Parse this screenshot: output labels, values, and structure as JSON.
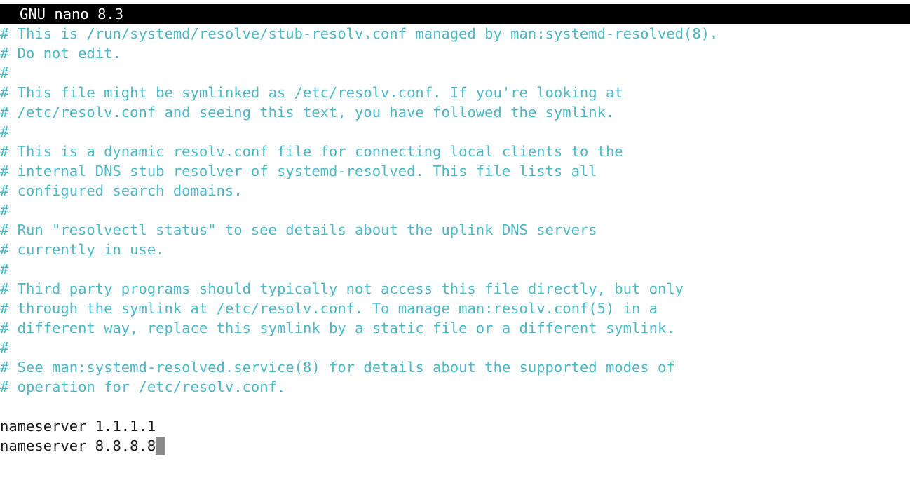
{
  "app": {
    "title": "GNU nano 8.3"
  },
  "editor": {
    "lines": [
      {
        "kind": "comment",
        "text": "# This is /run/systemd/resolve/stub-resolv.conf managed by man:systemd-resolved(8)."
      },
      {
        "kind": "comment",
        "text": "# Do not edit."
      },
      {
        "kind": "comment",
        "text": "#"
      },
      {
        "kind": "comment",
        "text": "# This file might be symlinked as /etc/resolv.conf. If you're looking at"
      },
      {
        "kind": "comment",
        "text": "# /etc/resolv.conf and seeing this text, you have followed the symlink."
      },
      {
        "kind": "comment",
        "text": "#"
      },
      {
        "kind": "comment",
        "text": "# This is a dynamic resolv.conf file for connecting local clients to the"
      },
      {
        "kind": "comment",
        "text": "# internal DNS stub resolver of systemd-resolved. This file lists all"
      },
      {
        "kind": "comment",
        "text": "# configured search domains."
      },
      {
        "kind": "comment",
        "text": "#"
      },
      {
        "kind": "comment",
        "text": "# Run \"resolvectl status\" to see details about the uplink DNS servers"
      },
      {
        "kind": "comment",
        "text": "# currently in use."
      },
      {
        "kind": "comment",
        "text": "#"
      },
      {
        "kind": "comment",
        "text": "# Third party programs should typically not access this file directly, but only"
      },
      {
        "kind": "comment",
        "text": "# through the symlink at /etc/resolv.conf. To manage man:resolv.conf(5) in a"
      },
      {
        "kind": "comment",
        "text": "# different way, replace this symlink by a static file or a different symlink."
      },
      {
        "kind": "comment",
        "text": "#"
      },
      {
        "kind": "comment",
        "text": "# See man:systemd-resolved.service(8) for details about the supported modes of"
      },
      {
        "kind": "comment",
        "text": "# operation for /etc/resolv.conf."
      },
      {
        "kind": "blank",
        "text": ""
      },
      {
        "kind": "plain",
        "text": "nameserver 1.1.1.1"
      },
      {
        "kind": "plain",
        "text": "nameserver 8.8.8.8",
        "cursor": true
      }
    ]
  },
  "colors": {
    "comment": "#4db8c6",
    "text": "#1a1a1a",
    "titlebar_bg": "#000000",
    "titlebar_fg": "#ffffff",
    "cursor": "#8a8a8a"
  }
}
